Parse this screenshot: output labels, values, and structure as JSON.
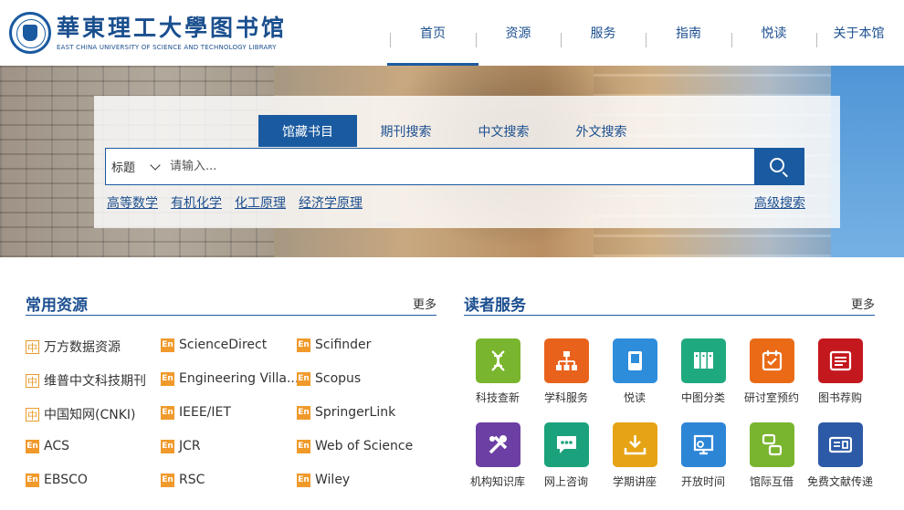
{
  "header": {
    "logo_cn": "華東理工大學图书馆",
    "logo_en": "EAST CHINA UNIVERSITY OF SCIENCE AND TECHNOLOGY LIBRARY",
    "nav": [
      "首页",
      "资源",
      "服务",
      "指南",
      "悦读",
      "关于本馆"
    ]
  },
  "search": {
    "tabs": [
      "馆藏书目",
      "期刊搜索",
      "中文搜索",
      "外文搜索"
    ],
    "scope": "标题",
    "placeholder": "请输入...",
    "hot": [
      "高等数学",
      "有机化学",
      "化工原理",
      "经济学原理"
    ],
    "advanced": "高级搜索"
  },
  "resources": {
    "title": "常用资源",
    "more": "更多",
    "items": [
      {
        "badge": "中",
        "name": "万方数据资源"
      },
      {
        "badge": "En",
        "name": "ScienceDirect"
      },
      {
        "badge": "En",
        "name": "Scifinder"
      },
      {
        "badge": "中",
        "name": "维普中文科技期刊"
      },
      {
        "badge": "En",
        "name": "Engineering Villa..."
      },
      {
        "badge": "En",
        "name": "Scopus"
      },
      {
        "badge": "中",
        "name": "中国知网(CNKI)"
      },
      {
        "badge": "En",
        "name": "IEEE/IET"
      },
      {
        "badge": "En",
        "name": "SpringerLink"
      },
      {
        "badge": "En",
        "name": "ACS"
      },
      {
        "badge": "En",
        "name": "JCR"
      },
      {
        "badge": "En",
        "name": "Web of Science"
      },
      {
        "badge": "En",
        "name": "EBSCO"
      },
      {
        "badge": "En",
        "name": "RSC"
      },
      {
        "badge": "En",
        "name": "Wiley"
      }
    ]
  },
  "services": {
    "title": "读者服务",
    "more": "更多",
    "items": [
      {
        "name": "科技查新",
        "color": "#7ab52f",
        "icon": "dna-icon"
      },
      {
        "name": "学科服务",
        "color": "#e9621c",
        "icon": "org-chart-icon"
      },
      {
        "name": "悦读",
        "color": "#2d8ddb",
        "icon": "book-icon"
      },
      {
        "name": "中图分类",
        "color": "#1fa97f",
        "icon": "bookshelf-icon"
      },
      {
        "name": "研讨室预约",
        "color": "#ea6a16",
        "icon": "calendar-check-icon"
      },
      {
        "name": "图书荐购",
        "color": "#c4181f",
        "icon": "list-icon"
      },
      {
        "name": "机构知识库",
        "color": "#6c3fa4",
        "icon": "tools-icon"
      },
      {
        "name": "网上咨询",
        "color": "#1ba27c",
        "icon": "chat-icon"
      },
      {
        "name": "学期讲座",
        "color": "#e6a315",
        "icon": "download-tray-icon"
      },
      {
        "name": "开放时间",
        "color": "#2d85d6",
        "icon": "clock-screen-icon"
      },
      {
        "name": "馆际互借",
        "color": "#7ab52f",
        "icon": "exchange-icon"
      },
      {
        "name": "免费文献传递",
        "color": "#2c5aa6",
        "icon": "card-icon"
      }
    ]
  }
}
